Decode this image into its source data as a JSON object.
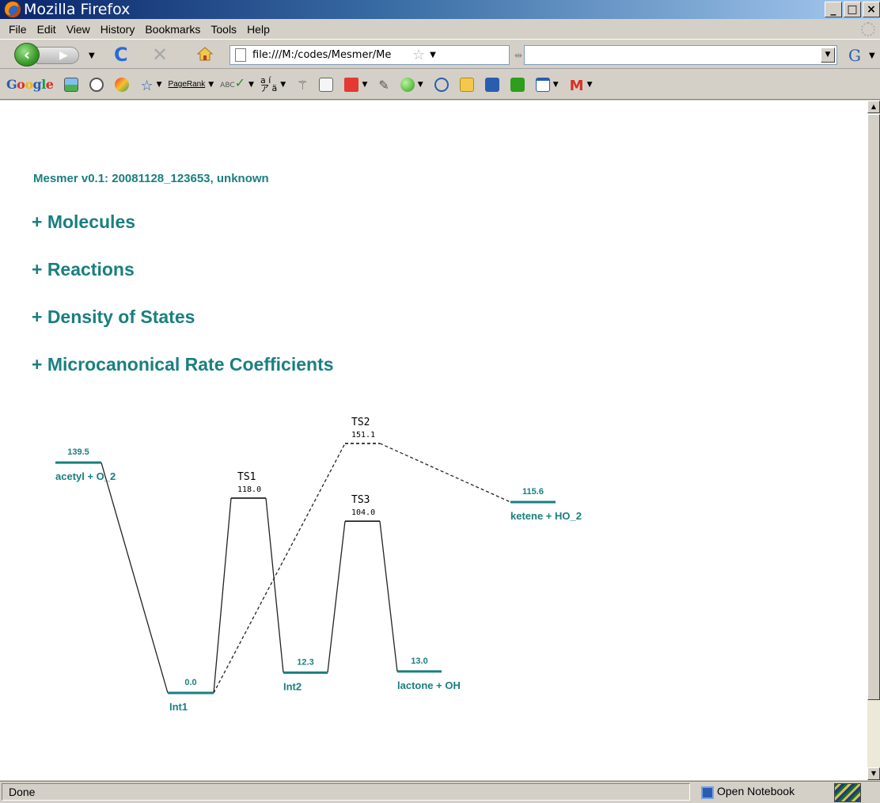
{
  "window": {
    "title": "Mozilla Firefox",
    "controls": [
      "_",
      "□",
      "×"
    ]
  },
  "menu": [
    "File",
    "Edit",
    "View",
    "History",
    "Bookmarks",
    "Tools",
    "Help"
  ],
  "nav": {
    "url": "file:///M:/codes/Mesmer/Me",
    "search_value": "",
    "search_engine": "G"
  },
  "google_toolbar": {
    "logo": "Google",
    "pagerank_label": "PageRank",
    "abc_label": "ABC",
    "ai_label": "a í\nア ä"
  },
  "content": {
    "version_line": "Mesmer v0.1: 20081128_123653, unknown",
    "sections": [
      "+ Molecules",
      "+ Reactions",
      "+ Density of States",
      "+ Microcanonical Rate Coefficients"
    ]
  },
  "diagram": {
    "colors": {
      "well": "#1a7f7f",
      "ts": "#000000",
      "link": "#222222"
    },
    "species": [
      {
        "name": "acetyl + O_2",
        "energy": "139.5",
        "kind": "well"
      },
      {
        "name": "Int1",
        "energy": "0.0",
        "kind": "well"
      },
      {
        "name": "TS1",
        "energy": "118.0",
        "kind": "ts"
      },
      {
        "name": "Int2",
        "energy": "12.3",
        "kind": "well"
      },
      {
        "name": "TS3",
        "energy": "104.0",
        "kind": "ts"
      },
      {
        "name": "lactone + OH",
        "energy": "13.0",
        "kind": "well"
      },
      {
        "name": "TS2",
        "energy": "151.1",
        "kind": "ts"
      },
      {
        "name": "ketene + HO_2",
        "energy": "115.6",
        "kind": "well"
      }
    ]
  },
  "status": {
    "text": "Done",
    "notebook_label": "Open Notebook"
  }
}
